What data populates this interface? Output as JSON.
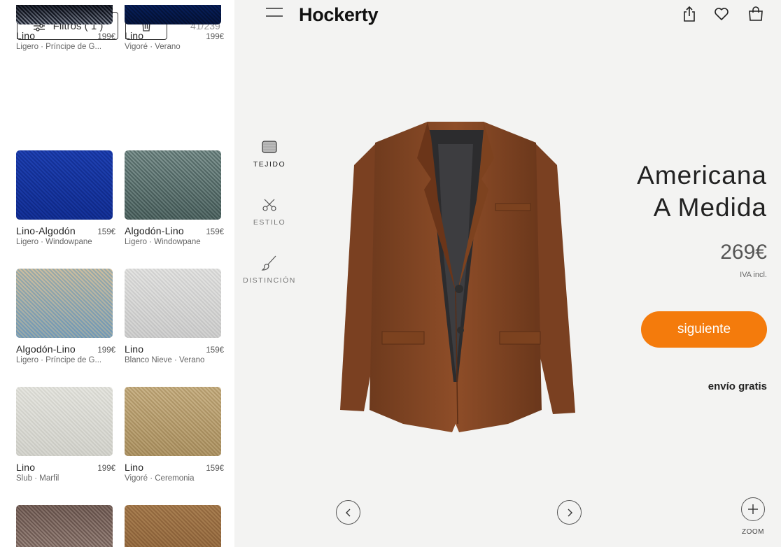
{
  "filters": {
    "label": "Filtros ( 1 )",
    "count": "41/239"
  },
  "fabrics": [
    {
      "name": "Lino",
      "price": "199€",
      "sub": "Ligero · Príncipe de G...",
      "color1": "#2a3040",
      "color2": "#b8bcc4"
    },
    {
      "name": "Lino",
      "price": "199€",
      "sub": "Vigoré · Verano",
      "color1": "#2b5a9a",
      "color2": "#1e3f6e"
    },
    {
      "name": "Lino-Algodón",
      "price": "159€",
      "sub": "Ligero · Windowpane",
      "color1": "#5a82d6",
      "color2": "#3c64b8"
    },
    {
      "name": "Algodón-Lino",
      "price": "159€",
      "sub": "Ligero · Windowpane",
      "color1": "#b6c4c2",
      "color2": "#7e918f"
    },
    {
      "name": "Algodón-Lino",
      "price": "199€",
      "sub": "Ligero · Príncipe de G...",
      "color1": "#e6dcc8",
      "color2": "#a8c4d8"
    },
    {
      "name": "Lino",
      "price": "159€",
      "sub": "Blanco Nieve · Verano",
      "color1": "#f1f1f0",
      "color2": "#dedede"
    },
    {
      "name": "Lino",
      "price": "199€",
      "sub": "Slub · Marfil",
      "color1": "#f2f2ef",
      "color2": "#e2e2de"
    },
    {
      "name": "Lino",
      "price": "159€",
      "sub": "Vigoré · Ceremonia",
      "color1": "#e3d6bb",
      "color2": "#c9b894"
    },
    {
      "name": "",
      "price": "",
      "sub": "",
      "color1": "#9d8c86",
      "color2": "#cfc3bd"
    },
    {
      "name": "",
      "price": "",
      "sub": "",
      "color1": "#d0b591",
      "color2": "#b59570"
    }
  ],
  "header": {
    "logo": "Hockerty"
  },
  "tools": {
    "fabric": "TEJIDO",
    "style": "ESTILO",
    "distinction": "DISTINCIÓN"
  },
  "product": {
    "title_line1": "Americana",
    "title_line2": "A Medida",
    "price": "269€",
    "tax": "IVA incl.",
    "cta": "siguiente",
    "shipping": "envío gratis",
    "jacket_color": "#8a4a26"
  },
  "zoom_label": "ZOOM"
}
